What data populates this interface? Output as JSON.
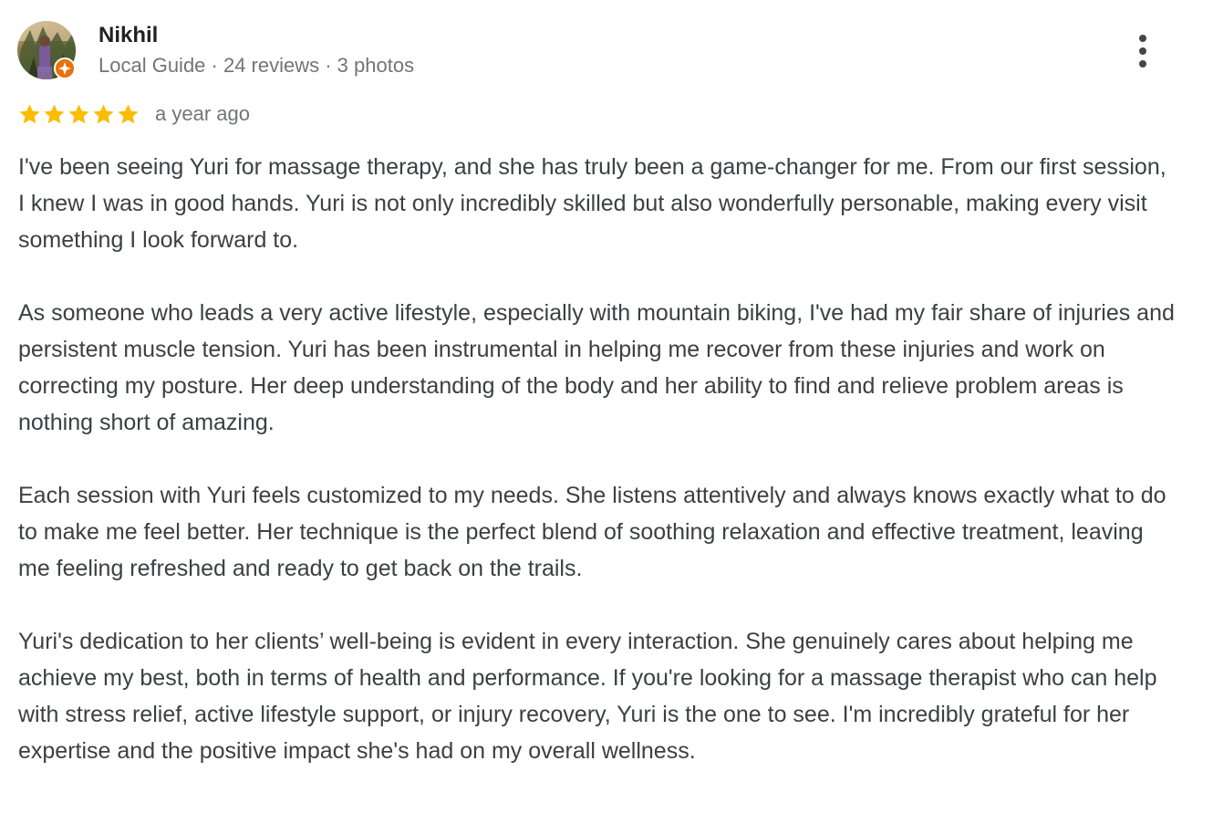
{
  "author": {
    "name": "Nikhil",
    "meta": "Local Guide · 24 reviews · 3 photos"
  },
  "rating": {
    "stars": 5,
    "max": 5,
    "date": "a year ago",
    "star_color": "#fbbc04"
  },
  "menu_icon": "more-vert-icon",
  "review": {
    "paragraphs": [
      "I've been seeing Yuri for massage therapy, and she has truly been a game-changer for me. From our first session, I knew I was in good hands. Yuri is not only incredibly skilled but also wonderfully personable, making every visit something I look forward to.",
      "As someone who leads a very active lifestyle, especially with mountain biking, I've had my fair share of injuries and persistent muscle tension. Yuri has been instrumental in helping me recover from these injuries and work on correcting my posture. Her deep understanding of the body and her ability to find and relieve problem areas is nothing short of amazing.",
      "Each session with Yuri feels customized to my needs. She listens attentively and always knows exactly what to do to make me feel better. Her technique is the perfect blend of soothing relaxation and effective treatment, leaving me feeling refreshed and ready to get back on the trails.",
      "Yuri's dedication to her clients’ well-being is evident in every interaction. She genuinely cares about helping me achieve my best, both in terms of health and performance. If you're looking for a massage therapist who can help with stress relief, active lifestyle support, or injury recovery, Yuri is the one to see. I'm incredibly grateful for her expertise and the positive impact she's had on my overall wellness."
    ]
  }
}
